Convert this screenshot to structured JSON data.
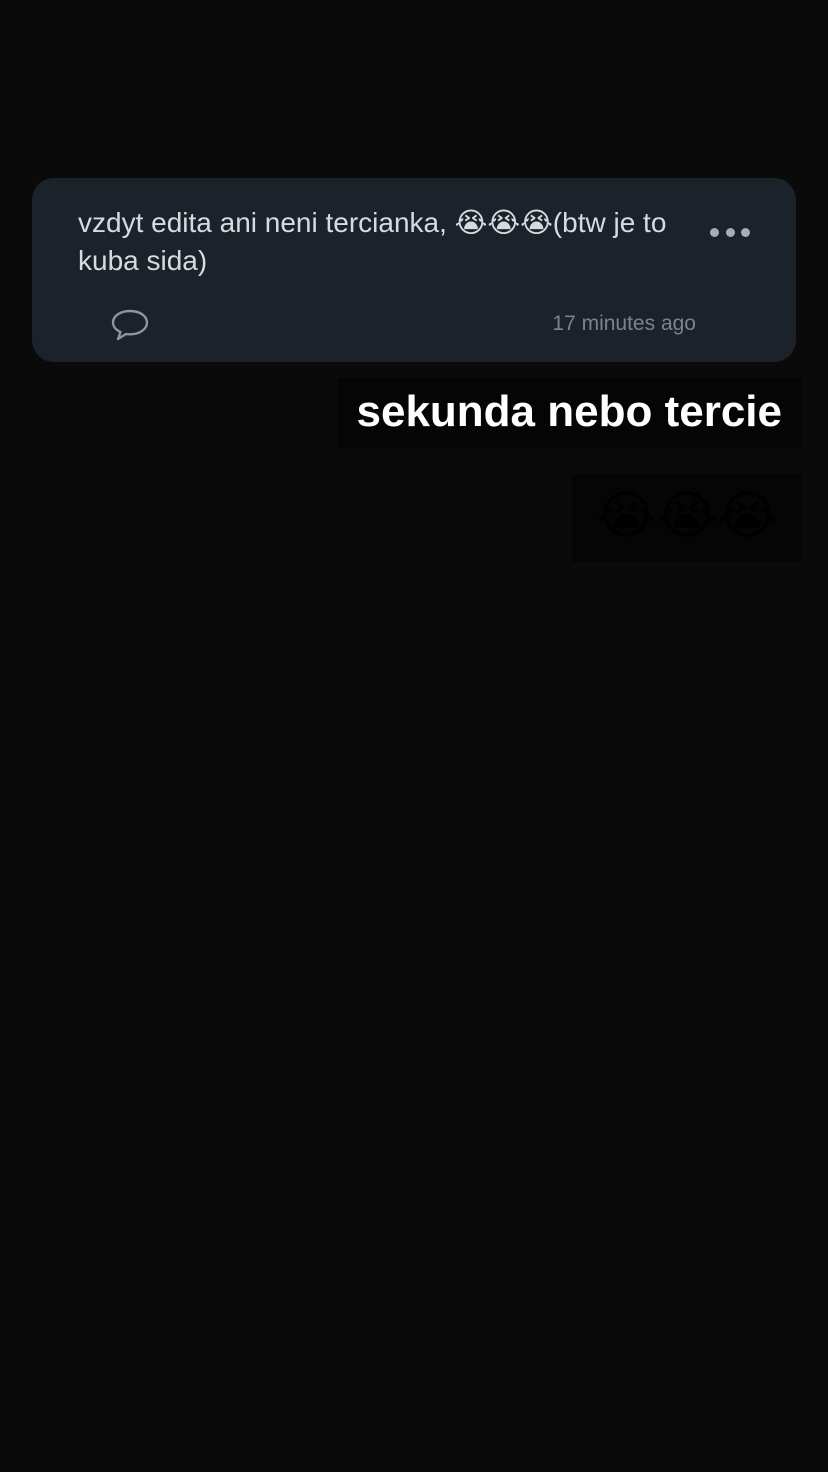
{
  "comment": {
    "text": "vzdyt edita ani neni tercianka, 😭😭😭(btw je to kuba sida)",
    "timestamp": "17 minutes ago",
    "reply_icon": "speech-bubble-icon",
    "more_icon": "more-dots-icon"
  },
  "story": {
    "caption": "sekunda nebo tercie",
    "emojis": "😭😭😭"
  },
  "colors": {
    "background": "#0a0a0b",
    "card": "#1c2229",
    "card_text": "#d6dbe1",
    "muted": "#7b838d",
    "caption_text": "#ffffff"
  }
}
